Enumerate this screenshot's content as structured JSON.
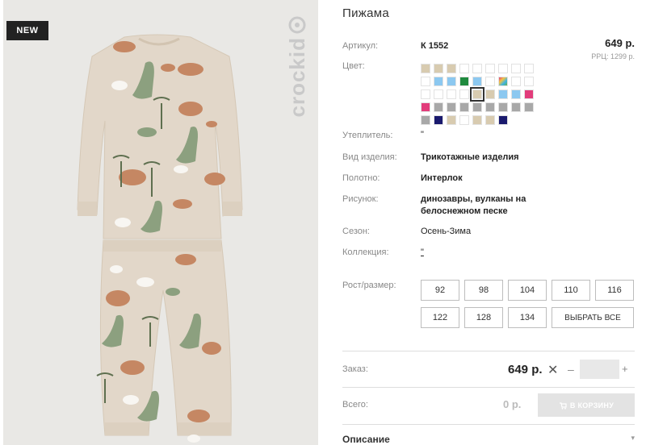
{
  "photo": {
    "badge": "NEW",
    "brand": "crockid",
    "background_color": "#e9e8e5",
    "fabric_color": "#e2d7c9"
  },
  "product": {
    "title": "Пижама",
    "sku_label": "Артикул:",
    "sku": "К 1552",
    "price": "649 р.",
    "rrp": "РРЦ: 1299 р.",
    "color_label": "Цвет:",
    "colors": [
      "#d8cbb0",
      "#d8cbb0",
      "#d8cbb0",
      "#ffffff",
      "#ffffff",
      "#ffffff",
      "#ffffff",
      "#ffffff",
      "#ffffff",
      "#ffffff",
      "#8cc8f0",
      "#8cc8f0",
      "#1f8a3e",
      "#8cc8f0",
      "#ffffff",
      "#multi",
      "#ffffff",
      "#ffffff",
      "#ffffff",
      "#ffffff",
      "#ffffff",
      "#ffffff",
      "#d8cbb0",
      "#d8cbb0",
      "#8cc8f0",
      "#8cc8f0",
      "#e23c7b",
      "#e23c7b",
      "#a8a8a8",
      "#a8a8a8",
      "#a8a8a8",
      "#a8a8a8",
      "#a8a8a8",
      "#a8a8a8",
      "#a8a8a8",
      "#a8a8a8",
      "#a8a8a8",
      "#1a1a6e",
      "#d8cbb0",
      "#ffffff",
      "#d8cbb0",
      "#d8cbb0",
      "#1a1a6e"
    ],
    "selected_color_index": 22,
    "filler_label": "Утеплитель:",
    "filler_value": "\"",
    "type_label": "Вид изделия:",
    "type_value": "Трикотажные изделия",
    "fabric_label": "Полотно:",
    "fabric_value": "Интерлок",
    "pattern_label": "Рисунок:",
    "pattern_line1": "динозавры, вулканы на",
    "pattern_line2": "белоснежном песке",
    "season_label": "Сезон:",
    "season_value": "Осень-Зима",
    "collection_label": "Коллекция:",
    "collection_value": "\"",
    "size_label": "Рост/размер:",
    "sizes": [
      "92",
      "98",
      "104",
      "110",
      "116",
      "122",
      "128",
      "134"
    ],
    "select_all": "ВЫБРАТЬ ВСЕ"
  },
  "order": {
    "label": "Заказ:",
    "price": "649 р.",
    "times": "✕",
    "minus": "–",
    "plus": "+",
    "qty": ""
  },
  "total": {
    "label": "Всего:",
    "value": "0 р.",
    "cart_button": "В КОРЗИНУ"
  },
  "description": {
    "label": "Описание",
    "chevron": "▾"
  }
}
